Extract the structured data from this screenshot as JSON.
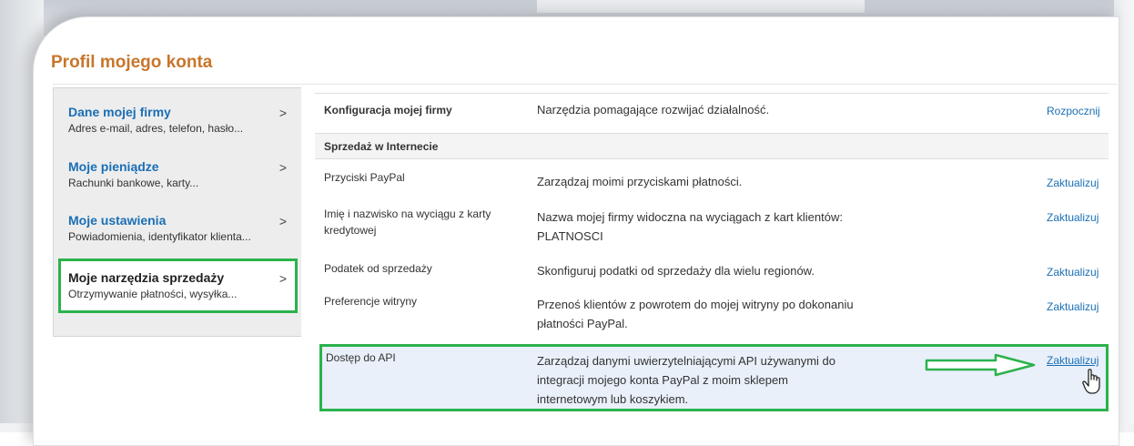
{
  "page": {
    "title": "Profil mojego konta"
  },
  "sidebar": {
    "items": [
      {
        "title": "Dane mojej firmy",
        "subtitle": "Adres e-mail, adres, telefon, hasło...",
        "chevron": ">"
      },
      {
        "title": "Moje pieniądze",
        "subtitle": "Rachunki bankowe, karty...",
        "chevron": ">"
      },
      {
        "title": "Moje ustawienia",
        "subtitle": "Powiadomienia, identyfikator klienta...",
        "chevron": ">"
      },
      {
        "title": "Moje narzędzia sprzedaży",
        "subtitle": "Otrzymywanie płatności, wysyłka...",
        "chevron": ">"
      }
    ]
  },
  "table": {
    "top_row": {
      "name": "Konfiguracja mojej firmy",
      "description": "Narzędzia pomagające rozwijać działalność.",
      "action": "Rozpocznij"
    },
    "section": "Sprzedaż w Internecie",
    "rows": [
      {
        "name": "Przyciski PayPal",
        "description": "Zarządzaj moimi przyciskami płatności.",
        "action": "Zaktualizuj"
      },
      {
        "name_line1": "Imię i nazwisko na wyciągu z karty",
        "name_line2": "kredytowej",
        "desc_line1": "Nazwa mojej firmy widoczna na wyciągach z kart klientów:",
        "desc_line2": "PLATNOSCI",
        "action": "Zaktualizuj"
      },
      {
        "name": "Podatek od sprzedaży",
        "description": "Skonfiguruj podatki od sprzedaży dla wielu regionów.",
        "action": "Zaktualizuj"
      },
      {
        "name": "Preferencje witryny",
        "desc_line1": "Przenoś klientów z powrotem do mojej witryny po dokonaniu",
        "desc_line2": "płatności PayPal.",
        "action": "Zaktualizuj"
      },
      {
        "name": "Dostęp do API",
        "desc_line1": "Zarządzaj danymi uwierzytelniającymi API używanymi do",
        "desc_line2": "integracji mojego konta PayPal z moim sklepem",
        "desc_line3": "internetowym lub koszykiem.",
        "action": "Zaktualizuj"
      }
    ]
  },
  "colors": {
    "title": "#c8762b",
    "link": "#1a6fb5",
    "highlight_border": "#2bb24c"
  }
}
